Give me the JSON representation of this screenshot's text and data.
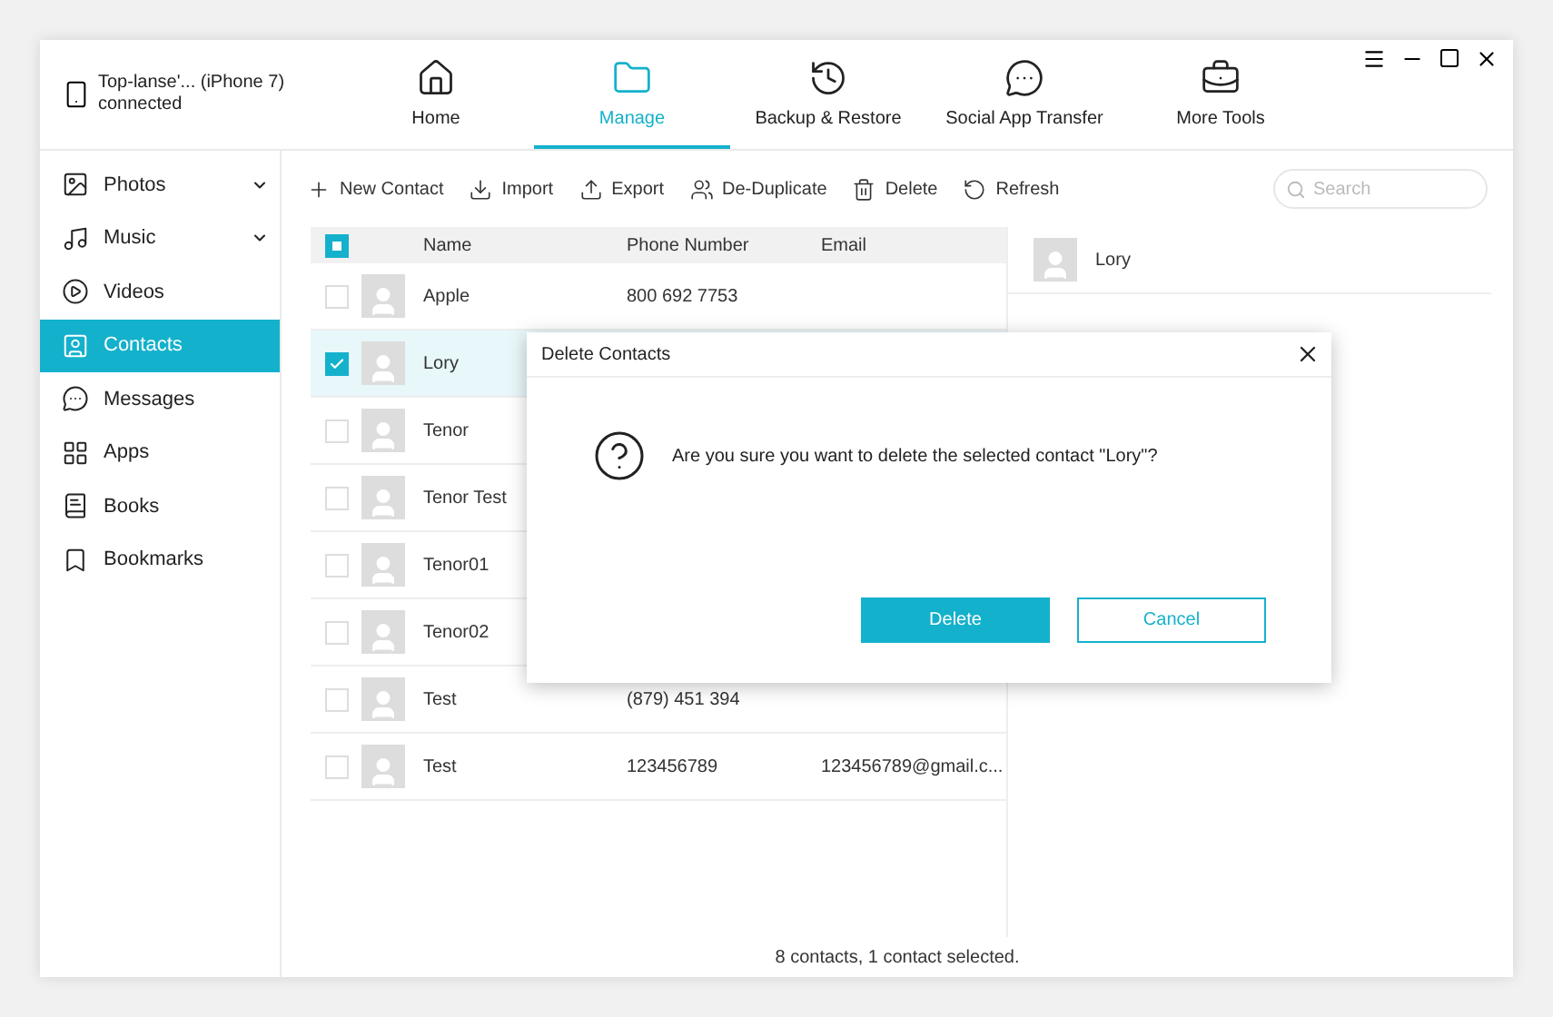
{
  "device": {
    "name": "Top-lanse'... (iPhone 7)",
    "status": "connected"
  },
  "nav": [
    {
      "label": "Home",
      "selected": false
    },
    {
      "label": "Manage",
      "selected": true
    },
    {
      "label": "Backup & Restore",
      "selected": false
    },
    {
      "label": "Social App Transfer",
      "selected": false
    },
    {
      "label": "More Tools",
      "selected": false
    }
  ],
  "sidebar": {
    "items": [
      {
        "label": "Photos",
        "selected": false,
        "expandable": true
      },
      {
        "label": "Music",
        "selected": false,
        "expandable": true
      },
      {
        "label": "Videos",
        "selected": false,
        "expandable": false
      },
      {
        "label": "Contacts",
        "selected": true,
        "expandable": false
      },
      {
        "label": "Messages",
        "selected": false,
        "expandable": false
      },
      {
        "label": "Apps",
        "selected": false,
        "expandable": false
      },
      {
        "label": "Books",
        "selected": false,
        "expandable": false
      },
      {
        "label": "Bookmarks",
        "selected": false,
        "expandable": false
      }
    ]
  },
  "toolbar": [
    "New Contact",
    "Import",
    "Export",
    "De-Duplicate",
    "Delete",
    "Refresh"
  ],
  "search": {
    "placeholder": "Search"
  },
  "table": {
    "partial": true,
    "columns": [
      "Name",
      "Phone Number",
      "Email"
    ],
    "rows": [
      {
        "name": "Apple",
        "phone": "800 692 7753",
        "email": "",
        "checked": false,
        "selected": false
      },
      {
        "name": "Lory",
        "phone": "",
        "email": "",
        "checked": true,
        "selected": true
      },
      {
        "name": "Tenor",
        "phone": "",
        "email": "",
        "checked": false,
        "selected": false
      },
      {
        "name": "Tenor Test",
        "phone": "",
        "email": "",
        "checked": false,
        "selected": false
      },
      {
        "name": "Tenor01",
        "phone": "",
        "email": "",
        "checked": false,
        "selected": false
      },
      {
        "name": "Tenor02",
        "phone": "",
        "email": "",
        "checked": false,
        "selected": false
      },
      {
        "name": "Test",
        "phone": "(879) 451 394",
        "email": "",
        "checked": false,
        "selected": false
      },
      {
        "name": "Test",
        "phone": "123456789",
        "email": "123456789@gmail.c...",
        "checked": false,
        "selected": false
      }
    ]
  },
  "detail": {
    "name": "Lory"
  },
  "status_bar": "8 contacts, 1 contact selected.",
  "dialog": {
    "title": "Delete Contacts",
    "message": "Are you sure you want to delete the selected contact \"Lory\"?",
    "buttons": [
      {
        "label": "Delete",
        "primary": true
      },
      {
        "label": "Cancel",
        "primary": false
      }
    ]
  }
}
